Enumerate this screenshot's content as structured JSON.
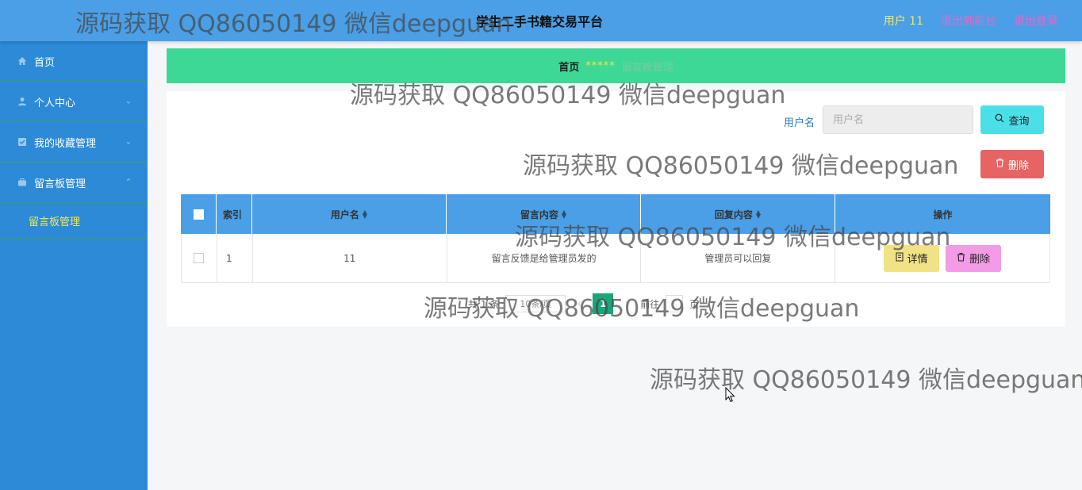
{
  "header": {
    "title": "学生二手书籍交易平台",
    "user": "用户 11",
    "back_to_front": "退出到前台",
    "logout": "退出登录"
  },
  "sidebar": {
    "items": [
      {
        "label": "首页",
        "icon": "home-icon"
      },
      {
        "label": "个人中心",
        "icon": "user-icon"
      },
      {
        "label": "我的收藏管理",
        "icon": "star-icon"
      },
      {
        "label": "留言板管理",
        "icon": "briefcase-icon"
      }
    ],
    "sub_item": "留言板管理"
  },
  "breadcrumb": {
    "home": "首页",
    "separator": "*****",
    "current": "留言板管理"
  },
  "search": {
    "label": "用户名",
    "placeholder": "用户名",
    "query_button": "查询",
    "delete_button": "删除"
  },
  "table": {
    "headers": [
      "索引",
      "用户名",
      "留言内容",
      "回复内容",
      "操作"
    ],
    "rows": [
      {
        "index": "1",
        "username": "11",
        "message": "留言反馈是给管理员发的",
        "reply": "管理员可以回复"
      }
    ],
    "detail_button": "详情",
    "delete_button": "删除"
  },
  "pagination": {
    "total": "共 1 条",
    "page_size": "10条/页",
    "current_page": "1",
    "goto_prefix": "前往",
    "goto_suffix": "页"
  },
  "watermark": "源码获取 QQ86050149 微信deepguan",
  "colors": {
    "header": "#4a9fe7",
    "sidebar": "#2d8ad6",
    "breadcrumb": "#3ed896",
    "query_button": "#4be0e8",
    "delete_button": "#e66464",
    "detail_button": "#f0e285",
    "row_delete_button": "#f29be6",
    "active_page": "#1aa67a"
  }
}
